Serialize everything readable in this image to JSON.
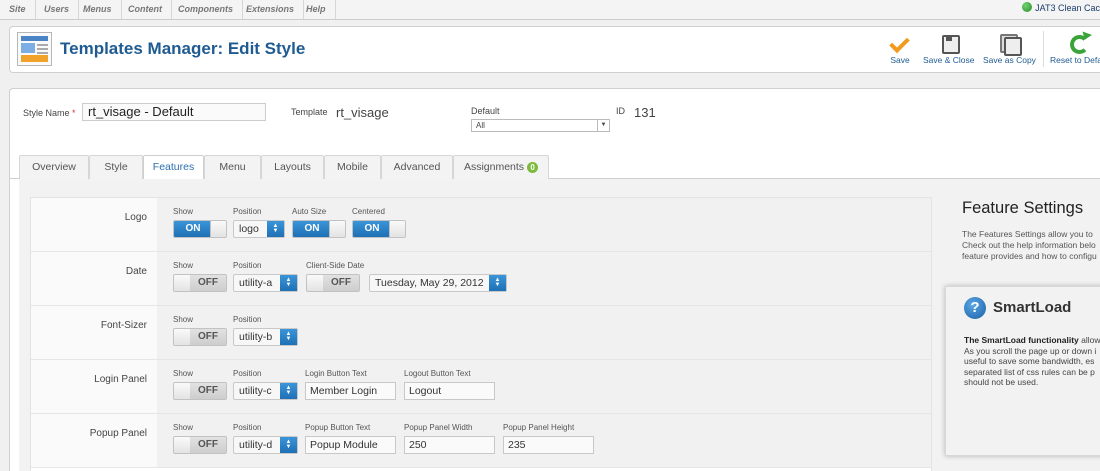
{
  "topmenu": {
    "items": [
      "Site",
      "Users",
      "Menus",
      "Content",
      "Components",
      "Extensions",
      "Help"
    ],
    "brand": "JAT3 Clean Cac"
  },
  "header": {
    "title": "Templates Manager: Edit Style",
    "toolbar": {
      "save": "Save",
      "save_close": "Save & Close",
      "save_copy": "Save as Copy",
      "reset": "Reset to Defau"
    }
  },
  "details": {
    "style_name_label": "Style Name",
    "required_mark": "*",
    "style_name_value": "rt_visage - Default",
    "template_label": "Template",
    "template_value": "rt_visage",
    "default_label": "Default",
    "default_value": "All",
    "id_label": "ID",
    "id_value": "131"
  },
  "tabs": [
    "Overview",
    "Style",
    "Features",
    "Menu",
    "Layouts",
    "Mobile",
    "Advanced",
    "Assignments"
  ],
  "active_tab": "Features",
  "assignments_count": "0",
  "features": {
    "logo": {
      "label": "Logo",
      "show_label": "Show",
      "show": "ON",
      "position_label": "Position",
      "position": "logo",
      "autosize_label": "Auto Size",
      "autosize": "ON",
      "centered_label": "Centered",
      "centered": "ON"
    },
    "date": {
      "label": "Date",
      "show_label": "Show",
      "show": "OFF",
      "position_label": "Position",
      "position": "utility-a",
      "clientside_label": "Client-Side Date",
      "clientside": "OFF",
      "format": "Tuesday, May 29, 2012"
    },
    "fontsizer": {
      "label": "Font-Sizer",
      "show_label": "Show",
      "show": "OFF",
      "position_label": "Position",
      "position": "utility-b"
    },
    "login": {
      "label": "Login Panel",
      "show_label": "Show",
      "show": "OFF",
      "position_label": "Position",
      "position": "utility-c",
      "login_text_label": "Login Button Text",
      "login_text": "Member Login",
      "logout_text_label": "Logout Button Text",
      "logout_text": "Logout"
    },
    "popup": {
      "label": "Popup Panel",
      "show_label": "Show",
      "show": "OFF",
      "position_label": "Position",
      "position": "utility-d",
      "button_text_label": "Popup Button Text",
      "button_text": "Popup Module",
      "width_label": "Popup Panel Width",
      "width": "250",
      "height_label": "Popup Panel Height",
      "height": "235"
    }
  },
  "sidebar": {
    "title": "Feature Settings",
    "lines": [
      "The Features Settings allow you to",
      "Check out the help information belo",
      "feature provides and how to configu"
    ],
    "smartload": {
      "title": "SmartLoad",
      "bold": "The SmartLoad functionality",
      "bold_tail": " allow",
      "lines": [
        "As you scroll the page up or down i",
        "useful to save some bandwidth, es",
        "separated list of css rules can be p",
        "should not be used."
      ]
    }
  },
  "colors": {
    "accent": "#1f70b5",
    "title": "#1f5b93",
    "badge": "#7cba3b",
    "save_icon": "#f29a1e",
    "reset_icon": "#3aa33a"
  }
}
